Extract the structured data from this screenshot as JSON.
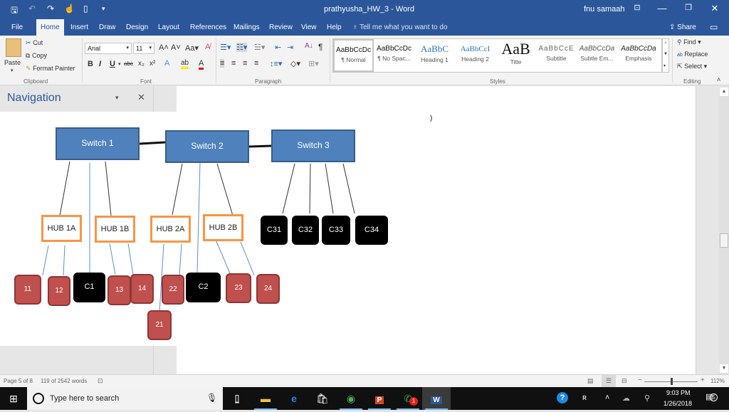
{
  "window": {
    "doc_title": "prathyusha_HW_3  -  Word",
    "user_name": "fnu samaah",
    "qat": [
      "save-icon",
      "undo-icon",
      "redo-icon",
      "touch-mode-icon",
      "new-doc-icon",
      "customize-qat-icon"
    ]
  },
  "tabs": [
    {
      "label": "File"
    },
    {
      "label": "Home",
      "active": true
    },
    {
      "label": "Insert"
    },
    {
      "label": "Draw"
    },
    {
      "label": "Design"
    },
    {
      "label": "Layout"
    },
    {
      "label": "References"
    },
    {
      "label": "Mailings"
    },
    {
      "label": "Review"
    },
    {
      "label": "View"
    },
    {
      "label": "Help"
    }
  ],
  "tell_me": "Tell me what you want to do",
  "share_label": "Share",
  "ribbon": {
    "clipboard": {
      "paste": "Paste",
      "cut": "Cut",
      "copy": "Copy",
      "format_painter": "Format Painter",
      "label": "Clipboard"
    },
    "font": {
      "name": "Arial",
      "size": "11",
      "label": "Font",
      "case": "Aa"
    },
    "paragraph": {
      "label": "Paragraph"
    },
    "styles": {
      "label": "Styles",
      "items": [
        {
          "preview": "AaBbCcDc",
          "name": "¶ Normal",
          "selected": true
        },
        {
          "preview": "AaBbCcDc",
          "name": "¶ No Spac..."
        },
        {
          "preview": "AaBbC",
          "name": "Heading 1"
        },
        {
          "preview": "AaBbCcI",
          "name": "Heading 2"
        },
        {
          "preview": "AaB",
          "name": "Title"
        },
        {
          "preview": "AaBbCcE",
          "name": "Subtitle"
        },
        {
          "preview": "AaBbCcDa",
          "name": "Subtle Em..."
        },
        {
          "preview": "AaBbCcDa",
          "name": "Emphasis"
        }
      ]
    },
    "editing": {
      "find": "Find",
      "replace": "Replace",
      "select": "Select",
      "label": "Editing"
    }
  },
  "navigation": {
    "title": "Navigation"
  },
  "diagram": {
    "switches": [
      "Switch 1",
      "Switch 2",
      "Switch 3"
    ],
    "hubs": [
      "HUB 1A",
      "HUB 1B",
      "HUB 2A",
      "HUB 2B"
    ],
    "computers_black": [
      "C31",
      "C32",
      "C33",
      "C34",
      "C1",
      "C2"
    ],
    "computers_red": [
      "11",
      "12",
      "13",
      "14",
      "22",
      "21",
      "23",
      "24"
    ]
  },
  "status": {
    "page": "Page 5 of 8",
    "words": "119 of 2542 words",
    "zoom_percent": "112%",
    "zoom_level": 112
  },
  "taskbar": {
    "search_placeholder": "Type here to search",
    "apps": [
      "task-view",
      "file-explorer",
      "edge",
      "store",
      "chrome",
      "powerpoint",
      "whatsapp",
      "word"
    ],
    "whatsapp_badge": "1",
    "time": "9:03 PM",
    "date": "1/26/2018",
    "notifications": "5"
  },
  "colors": {
    "word_blue": "#2b579a",
    "switch_fill": "#4f81bd",
    "hub_border": "#f79646",
    "node_red": "#c0504d"
  }
}
